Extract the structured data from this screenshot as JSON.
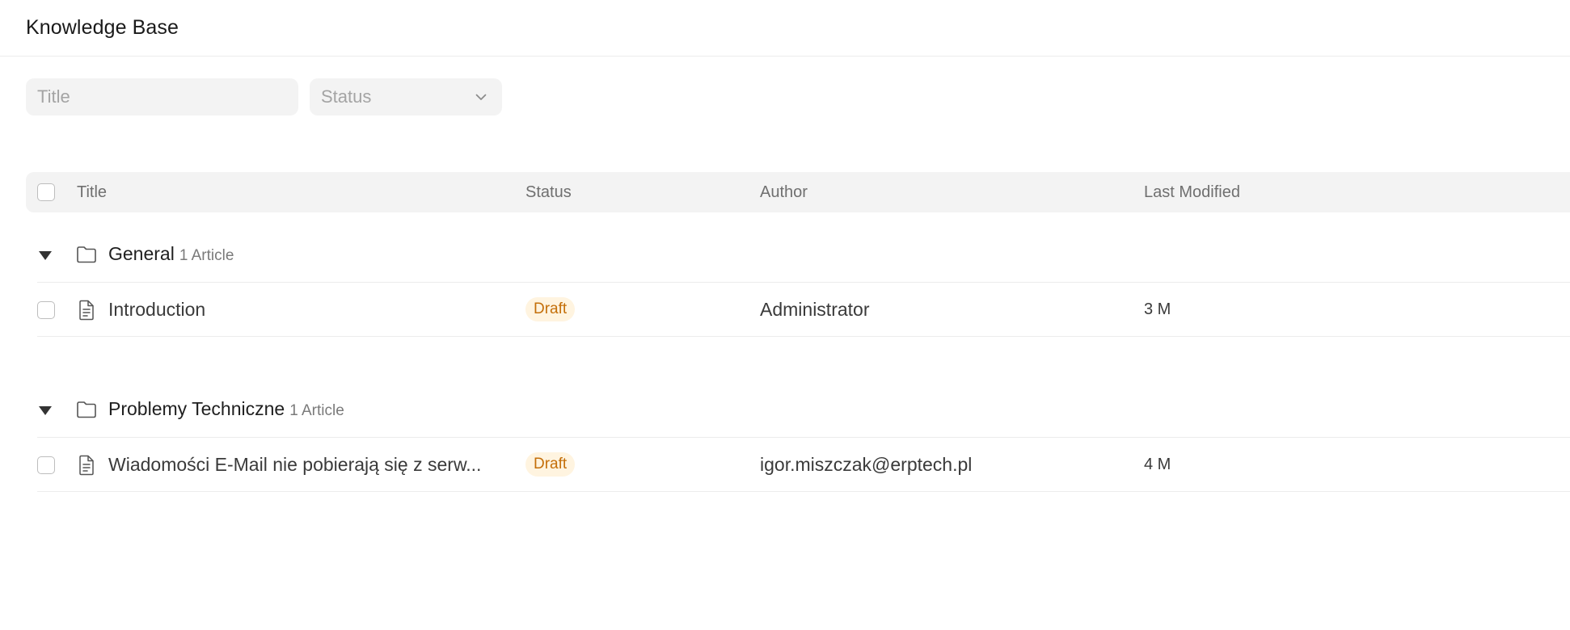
{
  "header": {
    "title": "Knowledge Base"
  },
  "filters": {
    "title_placeholder": "Title",
    "status_placeholder": "Status"
  },
  "table": {
    "columns": {
      "title": "Title",
      "status": "Status",
      "author": "Author",
      "modified": "Last Modified"
    },
    "groups": [
      {
        "name": "General",
        "count": "1 Article",
        "items": [
          {
            "title": "Introduction",
            "status": "Draft",
            "author": "Administrator",
            "modified": "3 M"
          }
        ]
      },
      {
        "name": "Problemy Techniczne",
        "count": "1 Article",
        "items": [
          {
            "title": "Wiadomości E-Mail nie pobierają się z serw...",
            "status": "Draft",
            "author": "igor.miszczak@erptech.pl",
            "modified": "4 M"
          }
        ]
      }
    ]
  },
  "icons": {
    "folder": "folder-icon",
    "document": "document-icon",
    "chevron": "chevron-down-icon",
    "caret": "caret-down-icon"
  },
  "colors": {
    "draft_badge_bg": "#fff4e0",
    "draft_badge_text": "#c46f0a",
    "surface": "#f3f3f3"
  }
}
